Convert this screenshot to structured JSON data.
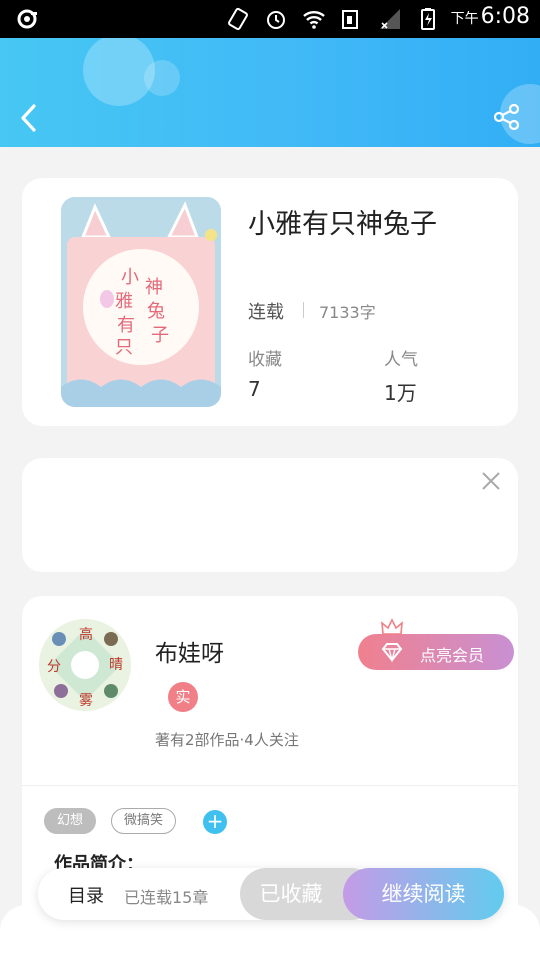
{
  "status_bar": {
    "ampm": "下午",
    "time": "6:08"
  },
  "header": {
    "back_icon": "chevron-left-icon",
    "share_icon": "share-icon"
  },
  "book": {
    "cover_text": [
      "小",
      "雅",
      "有",
      "只",
      "神",
      "兔",
      "子"
    ],
    "title": "小雅有只神兔子",
    "status": "连载",
    "words": "7133字",
    "stats": [
      {
        "label": "收藏",
        "value": "7"
      },
      {
        "label": "人气",
        "value": "1万"
      }
    ]
  },
  "ad": {
    "close_icon": "close-icon"
  },
  "author": {
    "avatar_chars": [
      "高",
      "晴",
      "分",
      "雾"
    ],
    "name": "布娃呀",
    "badge": "实",
    "meta": "著有2部作品·4人关注",
    "vip_label": "点亮会员"
  },
  "tags": [
    {
      "label": "幻想"
    },
    {
      "label": "微搞笑"
    }
  ],
  "tag_add": "+",
  "intro_label": "作品简介：",
  "action_bar": {
    "toc_label": "目录",
    "toc_count": "已连载15章",
    "collected_label": "已收藏",
    "read_label": "继续阅读"
  }
}
